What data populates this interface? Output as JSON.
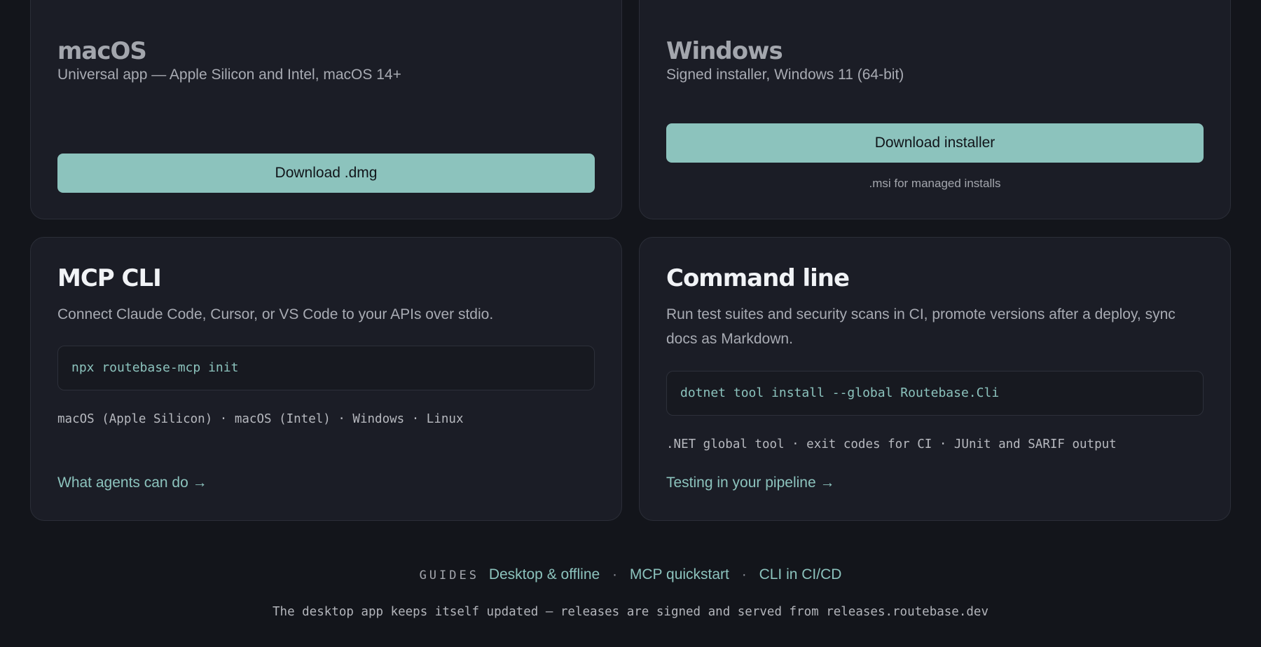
{
  "platforms": {
    "macos": {
      "title": "macOS",
      "description": "Universal app — Apple Silicon and Intel, macOS 14+",
      "button_label": "Download .dmg"
    },
    "windows": {
      "title": "Windows",
      "description": "Signed installer, Windows 11 (64-bit)",
      "button_label": "Download installer",
      "note": ".msi for managed installs"
    }
  },
  "tools": {
    "mcp": {
      "title": "MCP CLI",
      "description": "Connect Claude Code, Cursor, or VS Code to your APIs over stdio.",
      "command": "npx routebase-mcp init",
      "meta": "macOS (Apple Silicon) · macOS (Intel) · Windows · Linux",
      "link_label": "What agents can do →"
    },
    "cli": {
      "title": "Command line",
      "description": "Run test suites and security scans in CI, promote versions after a deploy, sync docs as Markdown.",
      "command": "dotnet tool install --global Routebase.Cli",
      "meta": ".NET global tool · exit codes for CI · JUnit and SARIF output",
      "link_label": "Testing in your pipeline →"
    }
  },
  "guides": {
    "label": "GUIDES",
    "links": [
      "Desktop & offline",
      "MCP quickstart",
      "CLI in CI/CD"
    ],
    "separator": "·"
  },
  "footer_note": "The desktop app keeps itself updated — releases are signed and served from releases.routebase.dev",
  "colors": {
    "accent": "#8cc3bd",
    "background": "#13151b",
    "card": "#1b1d26"
  }
}
